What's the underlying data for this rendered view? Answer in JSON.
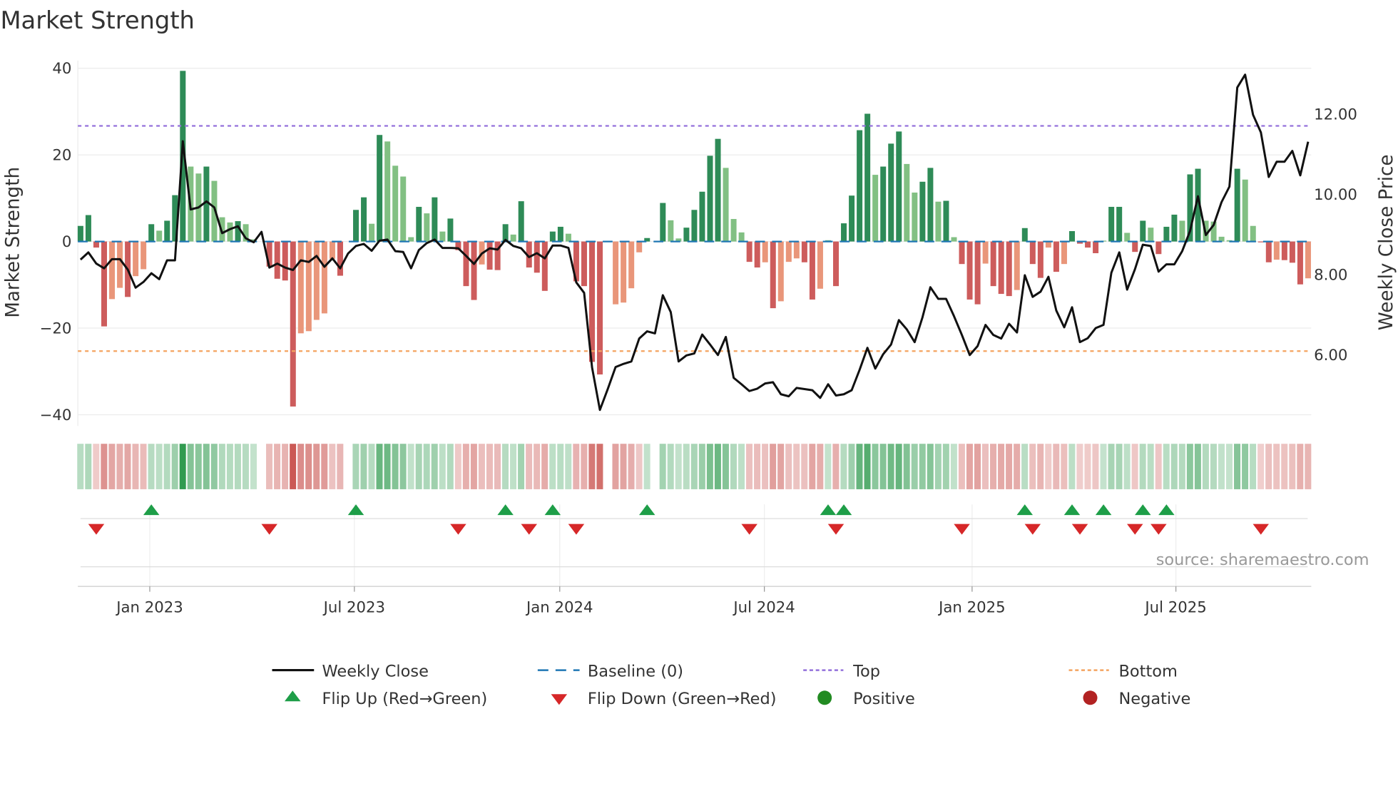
{
  "chart_data": {
    "type": "bar",
    "title": "Market Strength",
    "ylabel": "Market Strength",
    "y2label": "Weekly Close Price",
    "ylim": [
      -42,
      41
    ],
    "y2lim": [
      4.3,
      13.3
    ],
    "y_ticks": [
      "40",
      "20",
      "0",
      "−20",
      "−40"
    ],
    "y_tick_values": [
      40,
      20,
      0,
      -20,
      -40
    ],
    "y2_ticks": [
      "12.00",
      "10.00",
      "8.00",
      "6.00"
    ],
    "y2_tick_values": [
      12,
      10,
      8,
      6
    ],
    "x_ticks": [
      {
        "label": "Jan 2023",
        "week": 8.8
      },
      {
        "label": "Jul 2023",
        "week": 34.8
      },
      {
        "label": "Jan 2024",
        "week": 60.9
      },
      {
        "label": "Jul 2024",
        "week": 86.9
      },
      {
        "label": "Jan 2025",
        "week": 113.3
      },
      {
        "label": "Jul 2025",
        "week": 139.2
      }
    ],
    "top_level": 26.7,
    "bottom_level": -25.3,
    "strength": [
      3.6,
      6.1,
      -1.4,
      -19.6,
      -13.3,
      -10.7,
      -12.8,
      -8.0,
      -6.4,
      4.0,
      2.5,
      4.8,
      10.7,
      39.4,
      17.3,
      15.7,
      17.3,
      14.0,
      5.6,
      4.4,
      4.7,
      4.0,
      0.5,
      0,
      -5.8,
      -8.6,
      -9.0,
      -38.1,
      -21.2,
      -20.7,
      -18.1,
      -16.6,
      -4,
      -7.9,
      0,
      7.3,
      10.2,
      4.1,
      24.6,
      23.1,
      17.5,
      15.0,
      1.0,
      8.0,
      6.5,
      10.2,
      2.3,
      5.3,
      -2.0,
      -10.3,
      -13.5,
      -5.3,
      -6.5,
      -6.6,
      4.0,
      1.6,
      9.3,
      -6.0,
      -7.2,
      -11.4,
      2.3,
      3.4,
      1.8,
      -9.2,
      -10.3,
      -27.8,
      -30.7,
      0,
      -14.5,
      -14.1,
      -10.8,
      -2.5,
      0.8,
      0,
      8.9,
      4.9,
      0.7,
      3.2,
      7.3,
      11.5,
      19.8,
      23.7,
      17.0,
      5.2,
      2.1,
      -4.7,
      -6.0,
      -4.8,
      -15.4,
      -13.8,
      -4.7,
      -3.9,
      -4.8,
      -13.4,
      -10.9,
      0.3,
      -10.3,
      4.2,
      10.6,
      25.7,
      29.5,
      15.4,
      17.3,
      22.6,
      25.4,
      17.9,
      11.3,
      13.8,
      17.0,
      9.2,
      9.4,
      1.0,
      -5.2,
      -13.4,
      -14.5,
      -5.1,
      -10.3,
      -12.1,
      -12.6,
      -11.2,
      3.1,
      -5.2,
      -8.4,
      -1.4,
      -7.0,
      -5.2,
      2.4,
      -0.5,
      -1.4,
      -2.7,
      0.2,
      8.0,
      8.0,
      2.0,
      -2.4,
      4.8,
      3.2,
      -2.9,
      3.4,
      6.2,
      4.8,
      15.5,
      16.8,
      4.8,
      4.6,
      1.1,
      0.3,
      16.8,
      14.3,
      3.6,
      -0.2,
      -4.8,
      -4.2,
      -4.3,
      -4.9,
      -9.9,
      -8.5
    ],
    "tier": "GGRRrrRrrGgGGGggGgggGggzRRRRrrrrrRzGGgGggggGgGgGRRRrRRGgGRRRGGgRRRRzrrrrGzGggGGGGGgggRRrRrrrRRrgRGGGGgGGGggGGgGgRRRrRRRrGRRrRrGRRRgGGgRGgRGGgGGggggGggRRrRRRr",
    "tier_legend": {
      "G": "strong positive",
      "g": "weak positive",
      "R": "strong negative",
      "r": "weak negative",
      "z": "zero"
    },
    "weekly_close": [
      8.35,
      8.53,
      8.25,
      8.13,
      8.36,
      8.36,
      8.1,
      7.65,
      7.79,
      8.01,
      7.86,
      8.33,
      8.33,
      11.3,
      9.6,
      9.65,
      9.8,
      9.65,
      9.01,
      9.11,
      9.18,
      8.88,
      8.78,
      9.04,
      8.15,
      8.25,
      8.15,
      8.09,
      8.33,
      8.29,
      8.44,
      8.17,
      8.38,
      8.13,
      8.5,
      8.69,
      8.74,
      8.57,
      8.82,
      8.85,
      8.56,
      8.54,
      8.13,
      8.59,
      8.76,
      8.85,
      8.64,
      8.64,
      8.63,
      8.44,
      8.24,
      8.5,
      8.63,
      8.6,
      8.84,
      8.69,
      8.63,
      8.41,
      8.51,
      8.38,
      8.7,
      8.7,
      8.64,
      7.78,
      7.52,
      5.66,
      4.6,
      5.12,
      5.67,
      5.75,
      5.81,
      6.38,
      6.56,
      6.51,
      7.46,
      7.04,
      5.81,
      5.96,
      6.01,
      6.48,
      6.23,
      5.97,
      6.42,
      5.4,
      5.24,
      5.07,
      5.13,
      5.26,
      5.29,
      4.99,
      4.94,
      5.15,
      5.12,
      5.09,
      4.9,
      5.24,
      4.96,
      4.99,
      5.09,
      5.6,
      6.15,
      5.63,
      5.99,
      6.23,
      6.84,
      6.61,
      6.29,
      6.91,
      7.66,
      7.37,
      7.37,
      6.94,
      6.47,
      5.97,
      6.19,
      6.72,
      6.47,
      6.38,
      6.75,
      6.53,
      7.96,
      7.42,
      7.55,
      7.92,
      7.08,
      6.66,
      7.16,
      6.29,
      6.39,
      6.64,
      6.72,
      8.02,
      8.53,
      7.6,
      8.11,
      8.72,
      8.69,
      8.05,
      8.23,
      8.23,
      8.56,
      9.06,
      9.93,
      8.96,
      9.21,
      9.78,
      10.17,
      12.64,
      12.96,
      11.96,
      11.52,
      10.41,
      10.79,
      10.79,
      11.06,
      10.45,
      11.29
    ],
    "flip_up_weeks": [
      10,
      36,
      55,
      61,
      73,
      96,
      98,
      121,
      127,
      131,
      136,
      139
    ],
    "flip_down_weeks": [
      3,
      25,
      49,
      58,
      64,
      86,
      97,
      113,
      122,
      128,
      135,
      138,
      151
    ],
    "legend": {
      "weekly_close": "Weekly Close",
      "baseline": "Baseline (0)",
      "top": "Top",
      "bottom": "Bottom",
      "flip_up": "Flip Up (Red→Green)",
      "flip_down": "Flip Down (Green→Red)",
      "positive": "Positive",
      "negative": "Negative"
    },
    "source": "source: sharemaestro.com"
  },
  "colors": {
    "strong_pos": "#2e8b57",
    "weak_pos": "#82c083",
    "strong_neg": "#cd5c5c",
    "weak_neg": "#e9967a",
    "line": "#111111",
    "baseline": "#1f77b4",
    "top": "#9370db",
    "bottom": "#f4a460",
    "flip_up": "#1e9e48",
    "flip_down": "#d62728",
    "positive": "#228b22",
    "negative": "#b22222"
  }
}
